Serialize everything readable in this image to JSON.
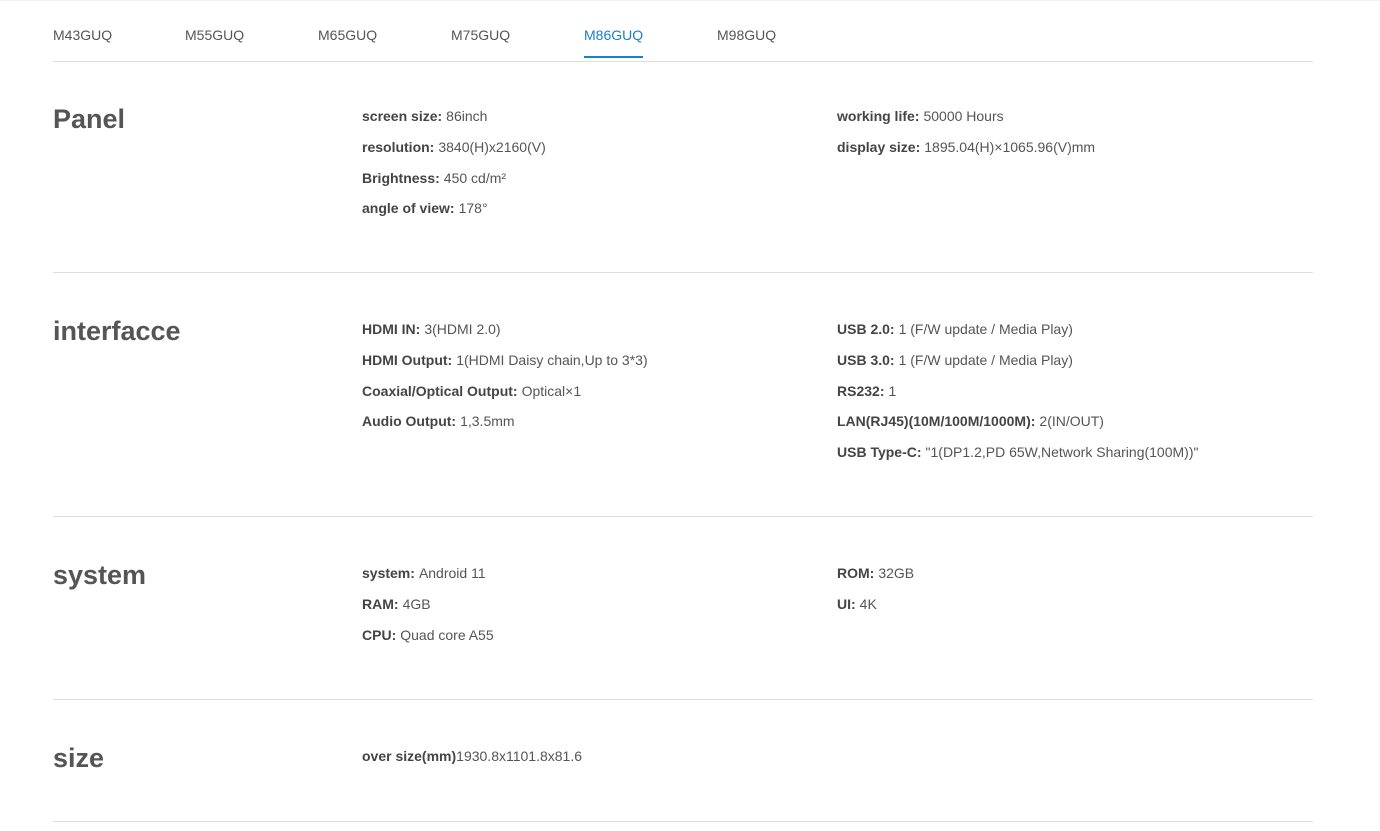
{
  "tabs": [
    {
      "label": "M43GUQ",
      "active": false
    },
    {
      "label": "M55GUQ",
      "active": false
    },
    {
      "label": "M65GUQ",
      "active": false
    },
    {
      "label": "M75GUQ",
      "active": false
    },
    {
      "label": "M86GUQ",
      "active": true
    },
    {
      "label": "M98GUQ",
      "active": false
    }
  ],
  "colors": {
    "accent": "#1a7fc7",
    "text": "#555555",
    "divider": "#dedede"
  },
  "sections": {
    "panel": {
      "title": "Panel",
      "left": [
        {
          "key": "screen size",
          "sep": ":",
          "value": "86inch"
        },
        {
          "key": "resolution",
          "sep": ":",
          "value": "3840(H)x2160(V)"
        },
        {
          "key": "Brightness",
          "sep": ":",
          "value": "450 cd/m²"
        },
        {
          "key": "angle of view",
          "sep": ":",
          "value": "178°"
        }
      ],
      "right": [
        {
          "key": "working life",
          "sep": ":",
          "value": "50000 Hours"
        },
        {
          "key": "display size",
          "sep": ":",
          "value": "1895.04(H)×1065.96(V)mm"
        }
      ]
    },
    "interface": {
      "title": "interfacce",
      "left": [
        {
          "key": "HDMI IN",
          "sep": ":",
          "value": "3(HDMI 2.0)"
        },
        {
          "key": "HDMI Output",
          "sep": ":",
          "value": "1(HDMI Daisy chain,Up to 3*3)"
        },
        {
          "key": "Coaxial/Optical Output",
          "sep": ":",
          "value": "Optical×1"
        },
        {
          "key": "Audio Output",
          "sep": ":",
          "value": "1,3.5mm"
        }
      ],
      "right": [
        {
          "key": "USB 2.0",
          "sep": ":",
          "value": "1 (F/W update / Media Play)"
        },
        {
          "key": "USB 3.0",
          "sep": ":",
          "value": "1 (F/W update / Media Play)"
        },
        {
          "key": "RS232",
          "sep": ":",
          "value": "1"
        },
        {
          "key": "LAN(RJ45)(10M/100M/1000M)",
          "sep": ":",
          "value": "2(IN/OUT)"
        },
        {
          "key": "USB Type-C",
          "sep": ":",
          "value": "\"1(DP1.2,PD 65W,Network Sharing(100M))\""
        }
      ]
    },
    "system": {
      "title": "system",
      "left": [
        {
          "key": "system",
          "sep": ":",
          "value": "Android 11"
        },
        {
          "key": "RAM",
          "sep": ":",
          "value": "4GB"
        },
        {
          "key": "CPU",
          "sep": ":",
          "value": "Quad core A55"
        }
      ],
      "right": [
        {
          "key": "ROM",
          "sep": ":",
          "value": "32GB"
        },
        {
          "key": "UI",
          "sep": ":",
          "value": "4K"
        }
      ]
    },
    "size": {
      "title": "size",
      "left": [
        {
          "key": "over size(mm)",
          "sep": "",
          "value": "1930.8x1101.8x81.6"
        }
      ],
      "right": []
    }
  }
}
